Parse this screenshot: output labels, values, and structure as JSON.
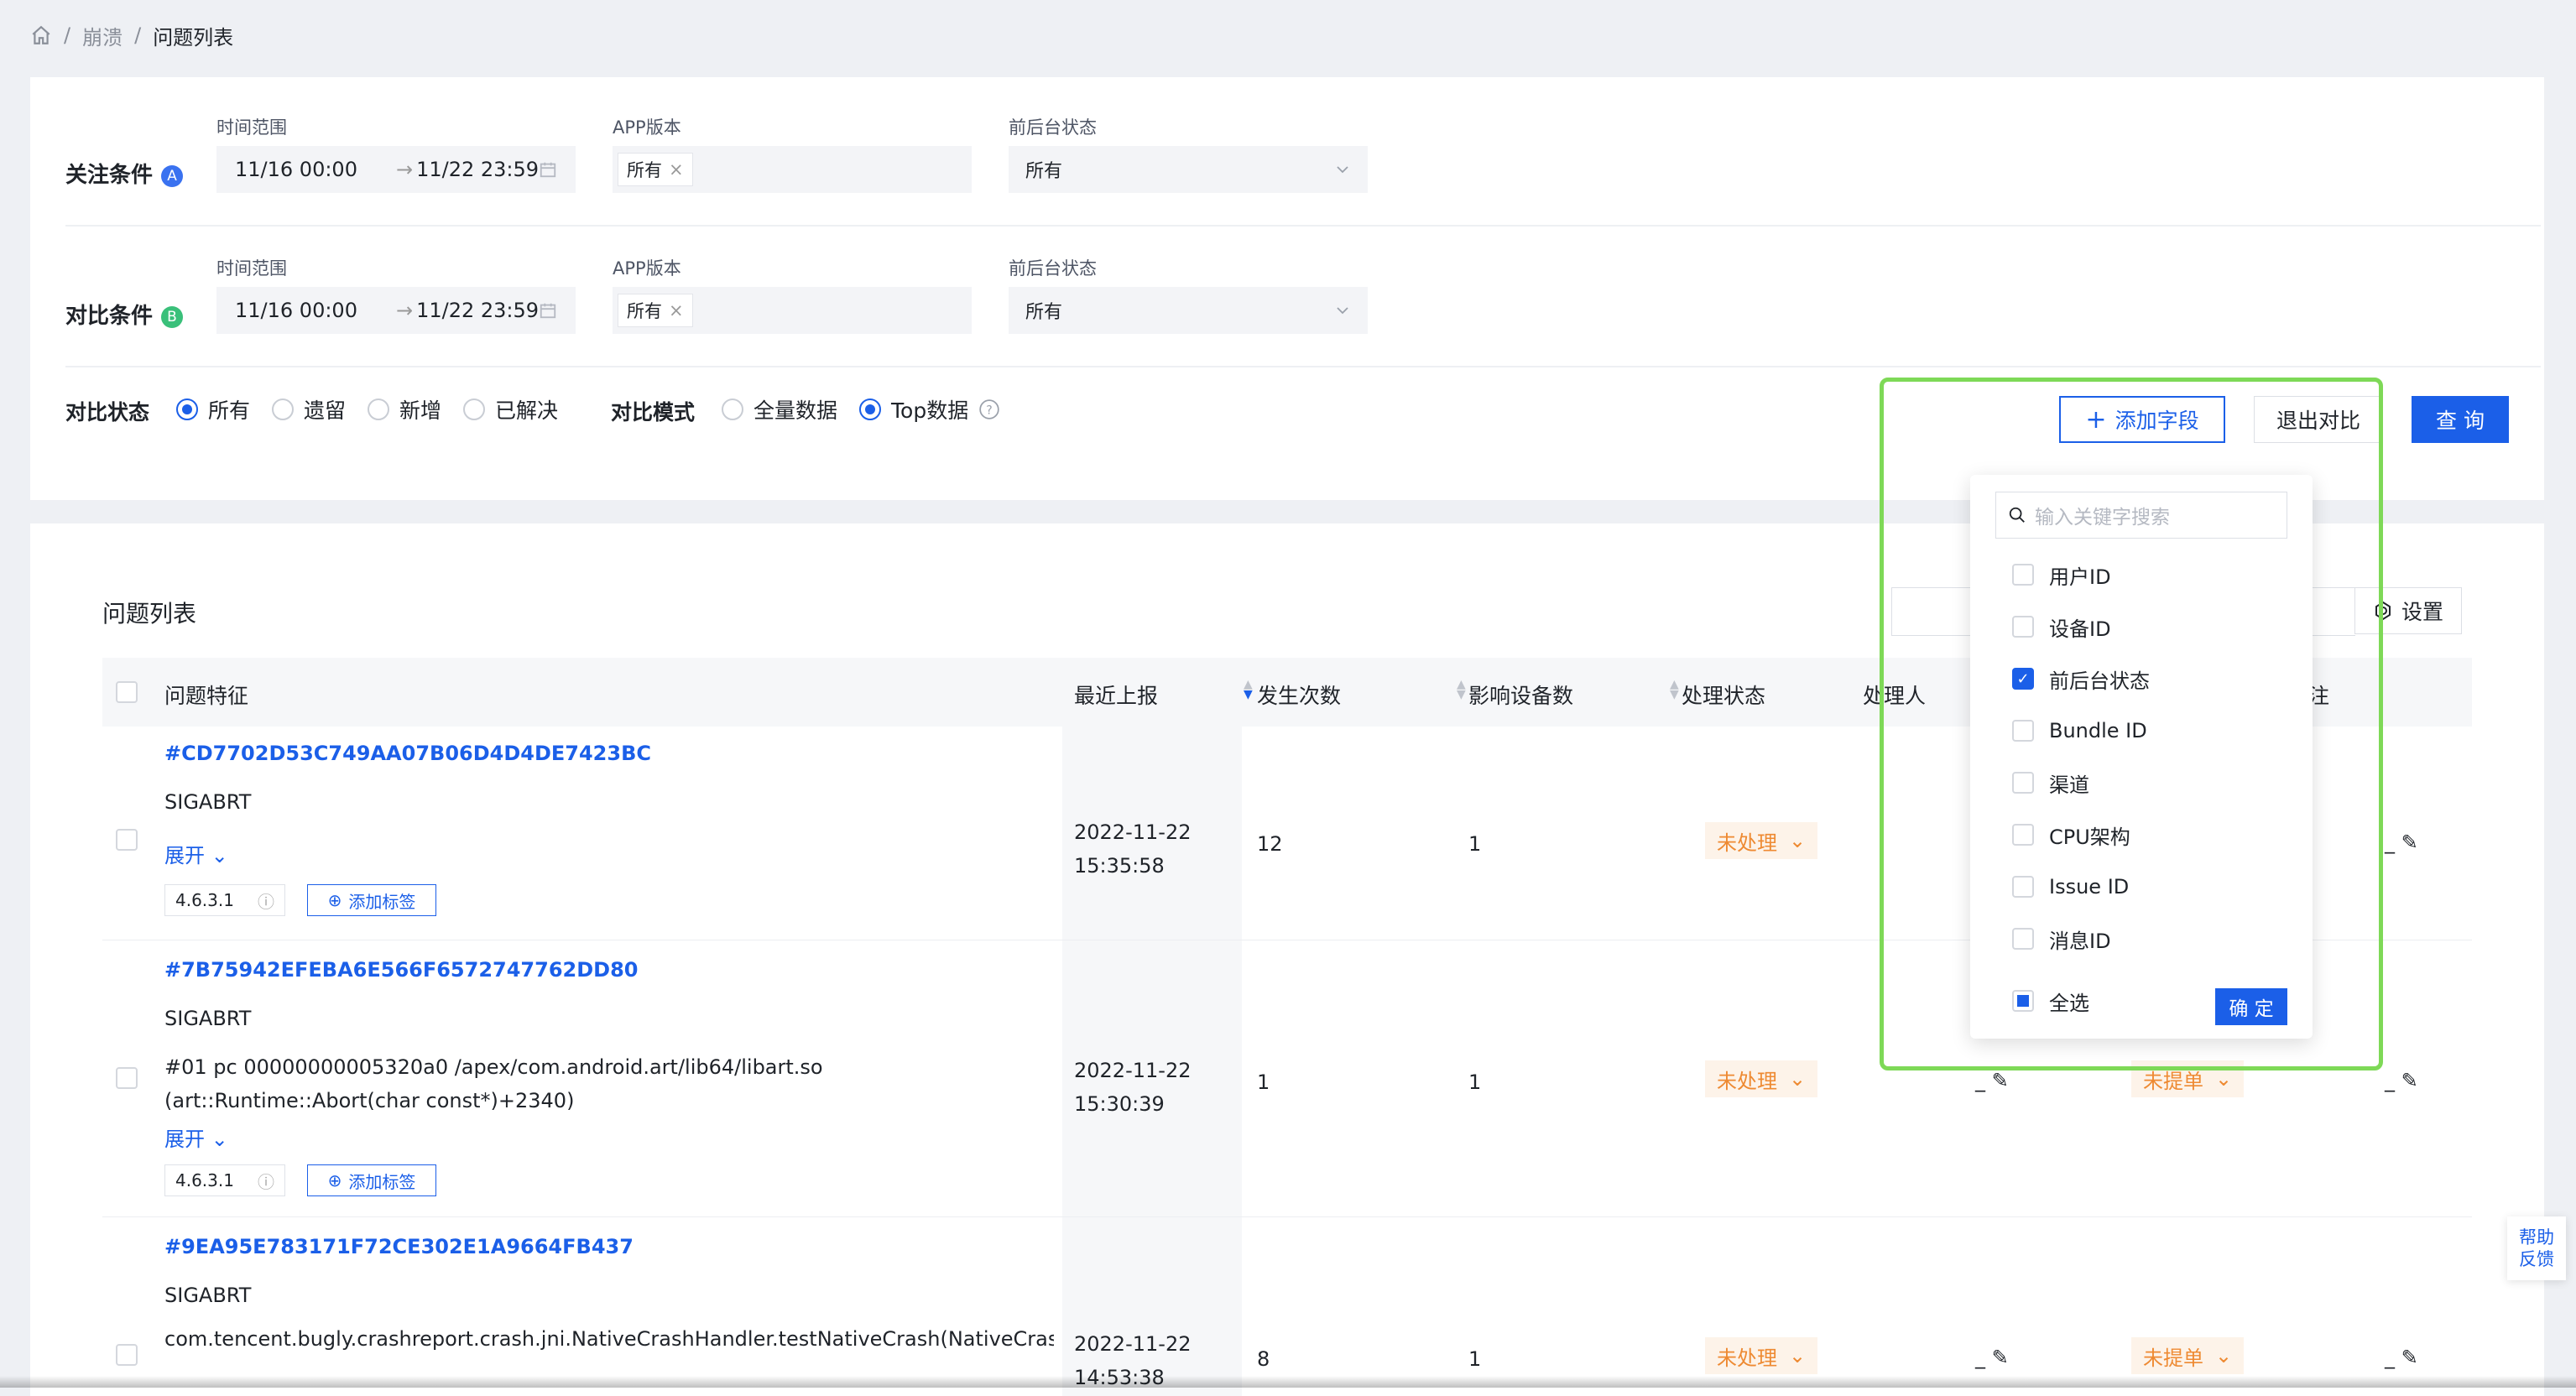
{
  "breadcrumb": {
    "items": [
      "崩溃",
      "问题列表"
    ]
  },
  "conditions": [
    {
      "label": "关注条件",
      "badge": "A",
      "badge_color": "#3a72f0",
      "time_label": "时间范围",
      "time_start": "11/16 00:00",
      "time_end": "11/22 23:59",
      "app_label": "APP版本",
      "app_tag": "所有",
      "state_label": "前后台状态",
      "state_value": "所有"
    },
    {
      "label": "对比条件",
      "badge": "B",
      "badge_color": "#3ac07a",
      "time_label": "时间范围",
      "time_start": "11/16 00:00",
      "time_end": "11/22 23:59",
      "app_label": "APP版本",
      "app_tag": "所有",
      "state_label": "前后台状态",
      "state_value": "所有"
    }
  ],
  "compare_state": {
    "label": "对比状态",
    "options": [
      "所有",
      "遗留",
      "新增",
      "已解决"
    ],
    "selected": "所有"
  },
  "compare_mode": {
    "label": "对比模式",
    "options": [
      "全量数据",
      "Top数据"
    ],
    "selected": "Top数据"
  },
  "actions": {
    "add_field": "添加字段",
    "exit_compare": "退出对比",
    "query": "查 询"
  },
  "list": {
    "title": "问题列表",
    "settings": "设置",
    "columns": [
      "问题特征",
      "最近上报",
      "发生次数",
      "影响设备数",
      "处理状态",
      "处理人",
      "备注"
    ],
    "rows": [
      {
        "id": "#CD7702D53C749AA07B06D4D4DE7423BC",
        "signal": "SIGABRT",
        "detail": "",
        "expand": "展开",
        "version": "4.6.3.1",
        "add_tag": "添加标签",
        "date": "2022-11-22",
        "time": "15:35:58",
        "count": "12",
        "devices": "1",
        "status": "未处理",
        "handler": "_",
        "note": "_"
      },
      {
        "id": "#7B75942EFEBA6E566F6572747762DD80",
        "signal": "SIGABRT",
        "detail": "#01 pc 00000000005320a0 /apex/com.android.art/lib64/libart.so (art::Runtime::Abort(char const*)+2340)",
        "expand": "展开",
        "version": "4.6.3.1",
        "add_tag": "添加标签",
        "date": "2022-11-22",
        "time": "15:30:39",
        "count": "1",
        "devices": "1",
        "status": "未处理",
        "handler": "_",
        "ticket": "未提单",
        "note": "_"
      },
      {
        "id": "#9EA95E783171F72CE302E1A9664FB437",
        "signal": "SIGABRT",
        "detail": "com.tencent.bugly.crashreport.crash.jni.NativeCrashHandler.testNativeCrash(NativeCrashHan",
        "date": "2022-11-22",
        "time": "14:53:38",
        "count": "8",
        "devices": "1",
        "status": "未处理",
        "handler": "_",
        "ticket": "未提单",
        "note": "_"
      }
    ]
  },
  "dropdown": {
    "search_placeholder": "输入关键字搜索",
    "items": [
      {
        "label": "用户ID",
        "checked": false
      },
      {
        "label": "设备ID",
        "checked": false
      },
      {
        "label": "前后台状态",
        "checked": true
      },
      {
        "label": "Bundle ID",
        "checked": false
      },
      {
        "label": "渠道",
        "checked": false
      },
      {
        "label": "CPU架构",
        "checked": false
      },
      {
        "label": "Issue ID",
        "checked": false
      },
      {
        "label": "消息ID",
        "checked": false
      }
    ],
    "select_all": "全选",
    "confirm": "确 定"
  },
  "help": {
    "line1": "帮助",
    "line2": "反馈"
  },
  "colors": {
    "primary": "#1b5fe8",
    "highlight": "#7ed957",
    "warning": "#ee8a32"
  }
}
